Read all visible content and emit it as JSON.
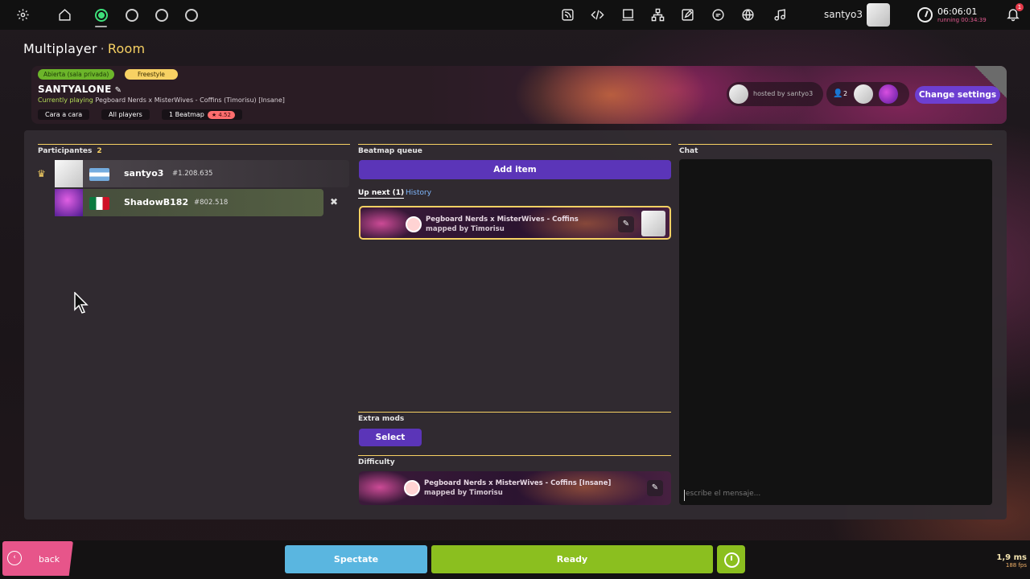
{
  "topbar": {
    "username": "santyo3",
    "clock_time": "06:06:01",
    "clock_running": "running 00:34:39",
    "notification_count": "1",
    "icons": [
      "settings-icon",
      "home-icon",
      "ruleset-osu-icon",
      "ruleset-taiko-icon",
      "ruleset-catch-icon",
      "ruleset-mania-icon",
      "rss-icon",
      "code-icon",
      "monitor-icon",
      "network-icon",
      "edit-icon",
      "chat-icon",
      "globe-icon",
      "music-icon"
    ]
  },
  "screen": {
    "title": "Multiplayer",
    "subtitle": "Room",
    "separator": "·"
  },
  "room": {
    "status_tag": "Abierta (sala privada)",
    "mode_tag": "Freestyle",
    "name": "SANTYALONE",
    "playing_label": "Currently playing",
    "playing_map": "Pegboard Nerds x MisterWives - Coffins (Timorisu) [Insane]",
    "chip_versus": "Cara a cara",
    "chip_players": "All players",
    "chip_beatmaps": "1 Beatmap",
    "chip_stars": "★ 4.52",
    "hosted_label": "hosted by",
    "host_name": "santyo3",
    "player_count": "2",
    "change_settings": "Change settings"
  },
  "participants": {
    "title": "Participantes",
    "count": "2",
    "players": [
      {
        "name": "santyo3",
        "rank": "#1.208.635",
        "flag": "AR",
        "host": true
      },
      {
        "name": "ShadowB182",
        "rank": "#802.518",
        "flag": "MX",
        "host": false
      }
    ]
  },
  "queue": {
    "title": "Beatmap queue",
    "add_item": "Add item",
    "tab_up_next": "Up next (1)",
    "tab_history": "History",
    "item": {
      "title": "Pegboard Nerds x MisterWives - Coffins",
      "mapped_by": "mapped by",
      "mapper": "Timorisu"
    }
  },
  "extra_mods": {
    "title": "Extra mods",
    "select": "Select"
  },
  "difficulty": {
    "title": "Difficulty",
    "map_title": "Pegboard Nerds x MisterWives - Coffins [Insane]",
    "mapped_by": "mapped by",
    "mapper": "Timorisu"
  },
  "chat": {
    "title": "Chat",
    "placeholder": "escribe el mensaje..."
  },
  "footer": {
    "back": "back",
    "spectate": "Spectate",
    "ready": "Ready",
    "ms": "1,9 ms",
    "fps": "188 fps"
  },
  "colors": {
    "accent_yellow": "#f7d163",
    "purple": "#5b35b8",
    "ready_green": "#8bbf1f",
    "spectate_blue": "#5ab6e0",
    "back_pink": "#e7558a"
  }
}
